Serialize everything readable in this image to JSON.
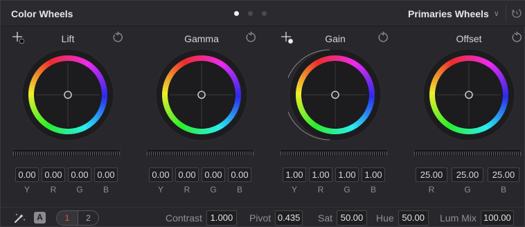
{
  "header": {
    "title": "Color Wheels",
    "page_dots": 3,
    "active_dot": 0,
    "mode": "Primaries Wheels",
    "mode_chevron_icon": "chevron-down-icon",
    "reset_all_icon": "reset-all-icon"
  },
  "wheels": [
    {
      "label": "Lift",
      "has_picker": true,
      "picker_icon": "picker-black-icon",
      "fields": [
        {
          "value": "0.00",
          "channel": "Y"
        },
        {
          "value": "0.00",
          "channel": "R"
        },
        {
          "value": "0.00",
          "channel": "G"
        },
        {
          "value": "0.00",
          "channel": "B"
        }
      ]
    },
    {
      "label": "Gamma",
      "has_picker": false,
      "fields": [
        {
          "value": "0.00",
          "channel": "Y"
        },
        {
          "value": "0.00",
          "channel": "R"
        },
        {
          "value": "0.00",
          "channel": "G"
        },
        {
          "value": "0.00",
          "channel": "B"
        }
      ]
    },
    {
      "label": "Gain",
      "has_picker": true,
      "picker_icon": "picker-white-icon",
      "fields": [
        {
          "value": "1.00",
          "channel": "Y"
        },
        {
          "value": "1.00",
          "channel": "R"
        },
        {
          "value": "1.00",
          "channel": "G"
        },
        {
          "value": "1.00",
          "channel": "B"
        }
      ]
    },
    {
      "label": "Offset",
      "has_picker": false,
      "fields": [
        {
          "value": "25.00",
          "channel": "R"
        },
        {
          "value": "25.00",
          "channel": "G"
        },
        {
          "value": "25.00",
          "channel": "B"
        }
      ]
    }
  ],
  "footer": {
    "pages": [
      "1",
      "2"
    ],
    "active_page": "1",
    "auto_label": "A",
    "params": [
      {
        "label": "Contrast",
        "value": "1.000"
      },
      {
        "label": "Pivot",
        "value": "0.435"
      },
      {
        "label": "Sat",
        "value": "50.00"
      },
      {
        "label": "Hue",
        "value": "50.00"
      },
      {
        "label": "Lum Mix",
        "value": "100.00"
      }
    ]
  },
  "colors": {
    "panel_bg": "#28282c",
    "field_bg": "#1f1f22",
    "active_page": "#ff4e3a"
  }
}
